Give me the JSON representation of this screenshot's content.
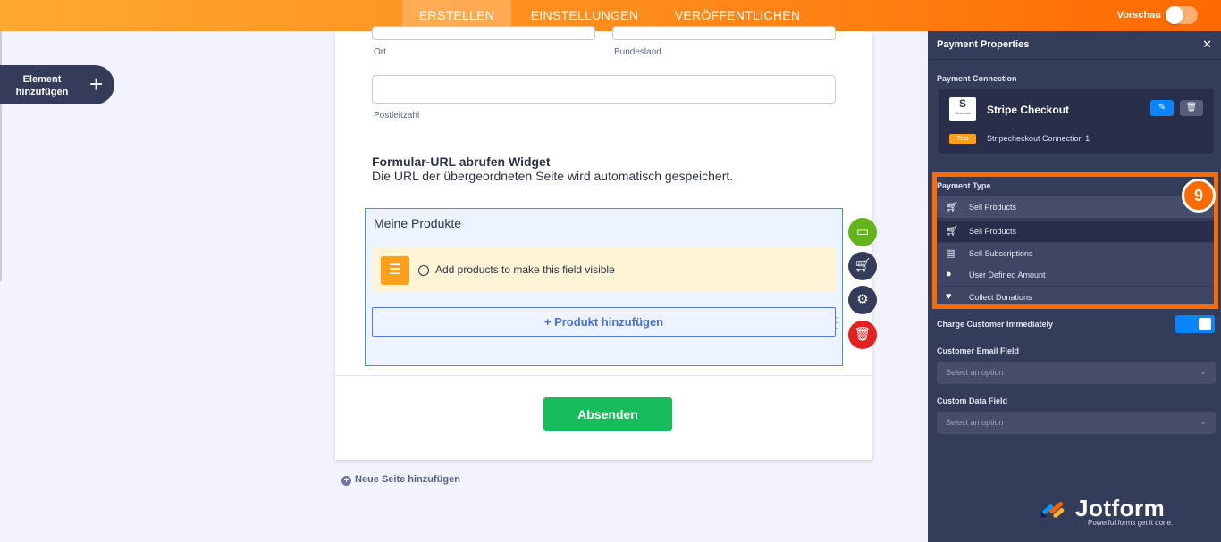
{
  "topbar": {
    "tabs": [
      {
        "label": "ERSTELLEN"
      },
      {
        "label": "EINSTELLUNGEN"
      },
      {
        "label": "VERÖFFENTLICHEN"
      }
    ],
    "preview_label": "Vorschau"
  },
  "left": {
    "add_element_label": "Element hinzufügen"
  },
  "form": {
    "city_label": "Ort",
    "state_label": "Bundesland",
    "zip_label": "Postleitzahl",
    "widget_title": "Formular-URL abrufen Widget",
    "widget_desc": "Die URL der übergeordneten Seite wird automatisch gespeichert.",
    "products_title": "Meine Produkte",
    "products_notice": "Add products to make this field visible",
    "add_product_label": "+ Produkt hinzufügen",
    "submit_label": "Absenden"
  },
  "new_page_label": "Neue Seite hinzufügen",
  "panel": {
    "title": "Payment Properties",
    "connection_label": "Payment Connection",
    "connection_name": "Stripe Checkout",
    "logo_letter": "S",
    "logo_sub": "Checkout",
    "test_badge": "Test",
    "connection_sub": "Stripecheckout Connection 1",
    "payment_type_label": "Payment Type",
    "payment_type_selected": "Sell Products",
    "payment_type_options": [
      {
        "label": "Sell Products",
        "icon": "cart-icon"
      },
      {
        "label": "Sell Subscriptions",
        "icon": "subscription-icon"
      },
      {
        "label": "User Defined Amount",
        "icon": "coins-icon"
      },
      {
        "label": "Collect Donations",
        "icon": "heart-hand-icon"
      }
    ],
    "charge_label": "Charge Customer Immediately",
    "email_field_label": "Customer Email Field",
    "email_placeholder": "Select an option",
    "custom_data_label": "Custom Data Field",
    "custom_data_placeholder": "Select an option",
    "step_number": "9",
    "brand_name": "Jotform",
    "brand_tagline": "Powerful forms get it done."
  },
  "colors": {
    "accent": "#ff6a00",
    "panel_bg": "#333c59",
    "submit_green": "#18bd5b",
    "primary_blue": "#0a84ff"
  }
}
